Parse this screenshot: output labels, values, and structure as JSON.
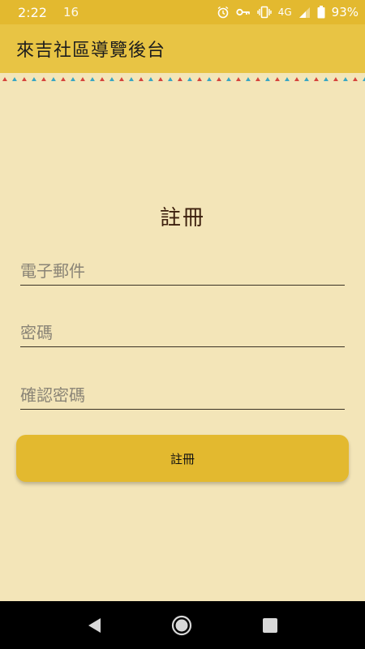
{
  "status_bar": {
    "time": "2:22",
    "notification": "16",
    "network": "4G",
    "battery_percent": "93%",
    "icons": [
      "alarm-icon",
      "key-icon",
      "vibrate-icon",
      "signal-icon",
      "battery-icon"
    ]
  },
  "app_bar": {
    "title": "來吉社區導覽後台",
    "color": "#e8c444"
  },
  "form": {
    "title": "註冊",
    "email_placeholder": "電子郵件",
    "password_placeholder": "密碼",
    "confirm_password_placeholder": "確認密碼",
    "submit_label": "註冊"
  },
  "colors": {
    "background": "#f3e5b8",
    "accent": "#e3b92f",
    "pattern": [
      "#d6453d",
      "#3aa6c4",
      "#f3e5b8"
    ]
  },
  "nav_bar": {
    "icons": [
      "back-icon",
      "home-icon",
      "recents-icon"
    ]
  }
}
